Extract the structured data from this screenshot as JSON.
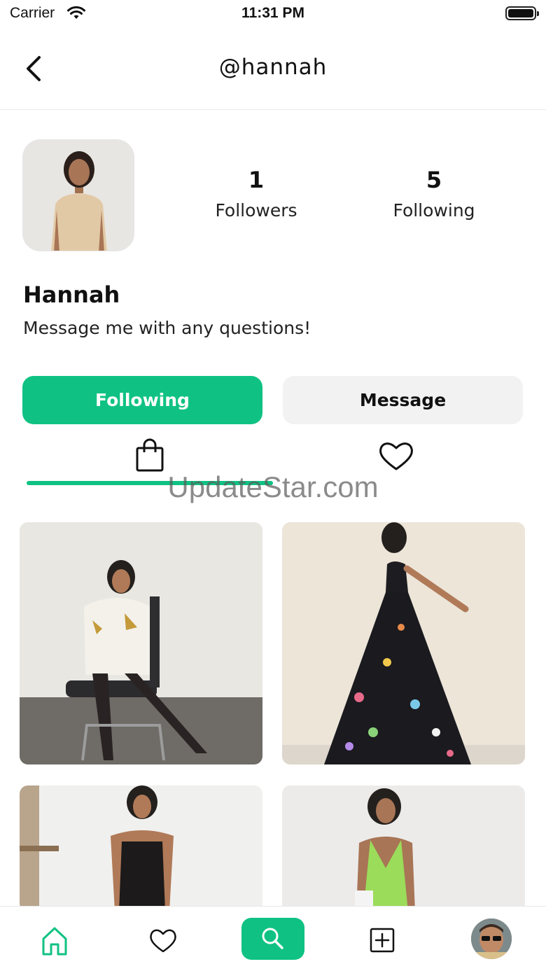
{
  "status_bar": {
    "carrier": "Carrier",
    "time": "11:31 PM"
  },
  "nav": {
    "title": "@hannah"
  },
  "profile": {
    "name": "Hannah",
    "bio": "Message me with any questions!",
    "followers_count": "1",
    "followers_label": "Followers",
    "following_count": "5",
    "following_label": "Following"
  },
  "actions": {
    "following_label": "Following",
    "message_label": "Message"
  },
  "tabs": [
    {
      "name": "shop",
      "icon": "shopping-bag-icon",
      "active": true
    },
    {
      "name": "likes",
      "icon": "heart-icon",
      "active": false
    }
  ],
  "watermark": "UpdateStar.com",
  "posts": [
    {
      "icon": "product-photo-icon"
    },
    {
      "icon": "product-photo-icon"
    },
    {
      "icon": "product-photo-icon"
    },
    {
      "icon": "product-photo-icon"
    }
  ],
  "bottom_nav": [
    {
      "name": "home",
      "icon": "home-icon",
      "active": true
    },
    {
      "name": "favorites",
      "icon": "heart-icon",
      "active": false
    },
    {
      "name": "search",
      "icon": "search-icon",
      "active": false
    },
    {
      "name": "add",
      "icon": "plus-square-icon",
      "active": false
    },
    {
      "name": "profile",
      "icon": "avatar-icon",
      "active": false
    }
  ],
  "colors": {
    "accent": "#0fc283",
    "secondary_button": "#f2f2f2"
  }
}
